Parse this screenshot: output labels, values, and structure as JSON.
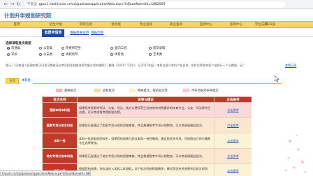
{
  "browser": {
    "security_label": "不安全",
    "url": "gpss1.hbzhiyuan.cn/zsj/gaokao/applicationNew.aspx?lnfJuanNameId=1882505"
  },
  "site": {
    "logo": "计划升学规划研究院"
  },
  "main_nav": {
    "items": [
      "首页",
      "招生计划",
      "院校信息",
      "批次线",
      "专业查询",
      "职业查询",
      "自测中心",
      "查询中心",
      "学位志愿"
    ],
    "date": "2021届"
  },
  "page_tabs": {
    "active": "志愿申请表",
    "links": [
      "填报简要说明",
      "填报示例"
    ]
  },
  "batch_section": {
    "title": "选择录取批次类型",
    "options_row1": [
      "普通类",
      "公安类",
      "免费师范生",
      "面向工程",
      "提前录取"
    ],
    "options_row2": [
      "军校",
      "公安类",
      "高职高专",
      "体育类",
      "艺术类"
    ]
  },
  "note": {
    "text": "提示：《河南省人民政府关于印发河南省深化考试招生制度改革实施方案的通知》（豫政〔2016〕52号），从2017年起，本科三批与本科二批合并，合并后简称本科二批执行一个分数线。另：",
    "link": "查看示例"
  },
  "sub_tabs": {
    "active": "主页",
    "inactive": "本科批"
  },
  "legend": [
    {
      "label": "重要批次",
      "color": "#f7b6b6"
    },
    {
      "label": "容易批次",
      "color": "#f9d9a8"
    },
    {
      "label": "特殊批次、提前批次等",
      "color": "#fbefc4"
    },
    {
      "label": "不符合报考条件批次",
      "color": "#f2c9c9"
    }
  ],
  "table": {
    "headers": [
      "批次名称",
      "说明与建议",
      "点击报考"
    ],
    "rows": [
      {
        "batch": "提前本科本科批",
        "desc": "如果您考虑报考军队、公安、司法、地方公费师范生及其他有特殊要求的体育专业，公安、司法等考生志愿，可以考虑报考提前批志愿。",
        "action": "点击报考",
        "style": "row-important"
      },
      {
        "batch": "国家专项计划本科批",
        "desc": "如果您已经通过了国家专项计划的资格审查，并且希望报考专项计划院校，可以考虑填报此批次。",
        "action": "点击报考",
        "style": "row-tiqian"
      },
      {
        "batch": "本科一批",
        "desc": "本科一批录取的院校中，如果您的成绩已超过本科一批控制线，建议您优先考虑，可按照自己的兴趣和专业选择院校。",
        "action": "点击报考",
        "style": "row-plain"
      },
      {
        "batch": "地方专项计划本科批",
        "desc": "如果您已经通过了地方专项计划的资格审查，并且希望报考专项计划院校，可以考虑填报此批次。",
        "action": "点击报考",
        "style": "row-tiqian"
      },
      {
        "batch": "本科二批",
        "desc": "根据您的成绩，你应该进入本科二批录取，这个批次院校数量最多，建议您优先考虑报考此批次的院校。",
        "action": "点击报考",
        "style": "row-plain"
      }
    ]
  },
  "status_bar": {
    "text": "hiyuan.cn/zsj/gaokao/applicationNew.aspx?lnfJuanNameId=188250"
  }
}
